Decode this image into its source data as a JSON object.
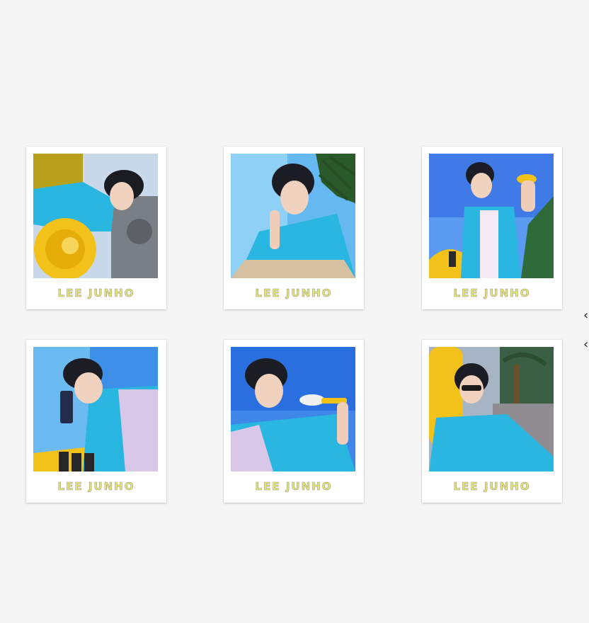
{
  "cards": [
    {
      "caption": "LEE JUNHO",
      "scene": "Man lying with yellow megaphone"
    },
    {
      "caption": "LEE JUNHO",
      "scene": "Man sitting, hand on cheek, palm leaves"
    },
    {
      "caption": "LEE JUNHO",
      "scene": "Man standing holding small yellow item"
    },
    {
      "caption": "LEE JUNHO",
      "scene": "Man holding dark can"
    },
    {
      "caption": "LEE JUNHO",
      "scene": "Man holding yellow popsicle"
    },
    {
      "caption": "LEE JUNHO",
      "scene": "Man with sunglasses, yellow float, palm tree"
    }
  ],
  "colors": {
    "caption_fill": "#e5e56a",
    "shirt": "#29b6e0",
    "sky": "#3a8ee8",
    "yellow": "#f2c21a"
  },
  "nav": {
    "left_icon": "chevron-left-icon"
  }
}
